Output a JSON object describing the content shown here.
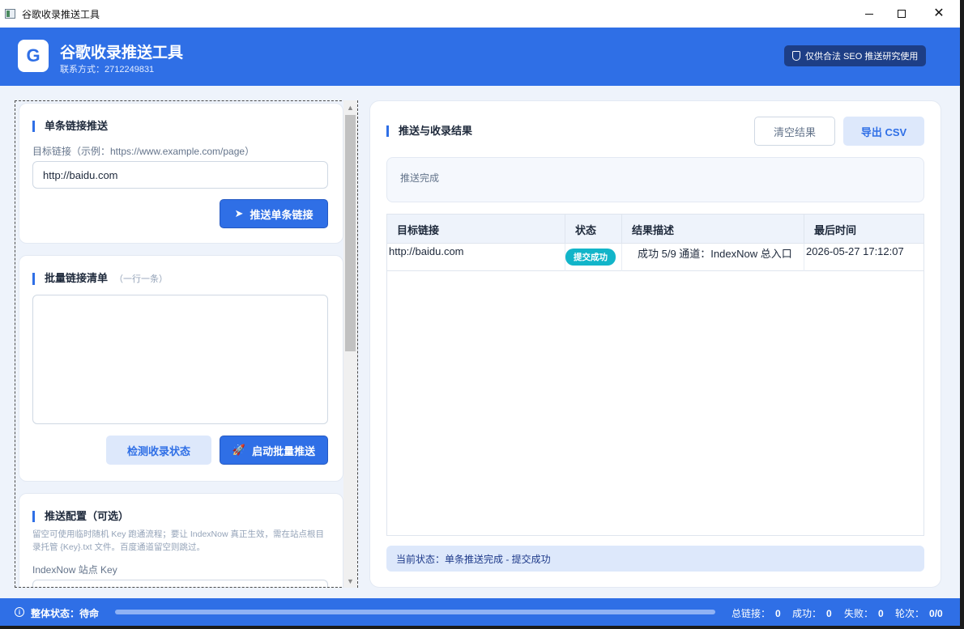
{
  "window": {
    "title": "谷歌收录推送工具"
  },
  "header": {
    "logo_letter": "G",
    "title": "谷歌收录推送工具",
    "contact": "联系方式：2712249831",
    "badge": "仅供合法 SEO 推送研究使用"
  },
  "single": {
    "title": "单条链接推送",
    "label": "目标链接（示例：https://www.example.com/page）",
    "value": "http://baidu.com",
    "button": "推送单条链接"
  },
  "batch": {
    "title": "批量链接清单",
    "hint": "（一行一条）",
    "check_button": "检测收录状态",
    "start_button": "启动批量推送"
  },
  "config": {
    "title": "推送配置（可选）",
    "desc": "留空可使用临时随机 Key 跑通流程；要让 IndexNow 真正生效，需在站点根目录托管 {Key}.txt 文件。百度通道留空则跳过。",
    "key_label": "IndexNow 站点 Key"
  },
  "results": {
    "title": "推送与收录结果",
    "clear_button": "清空结果",
    "export_button": "导出 CSV",
    "message": "推送完成",
    "columns": [
      "目标链接",
      "状态",
      "结果描述",
      "最后时间"
    ],
    "rows": [
      {
        "url": "http://baidu.com",
        "status": "提交成功",
        "desc": "成功 5/9 通道：IndexNow 总入口",
        "time": "2026-05-27 17:12:07"
      }
    ],
    "current_status": "当前状态：单条推送完成 - 提交成功"
  },
  "footer": {
    "overall": "整体状态：待命",
    "progress": 1.0,
    "total_label": "总链接：",
    "total": "0",
    "success_label": "成功：",
    "success": "0",
    "fail_label": "失败：",
    "fail": "0",
    "rounds_label": "轮次：",
    "rounds": "0/0"
  },
  "colors": {
    "accent": "#2f6fe6",
    "success_pill": "#12b5c9"
  }
}
